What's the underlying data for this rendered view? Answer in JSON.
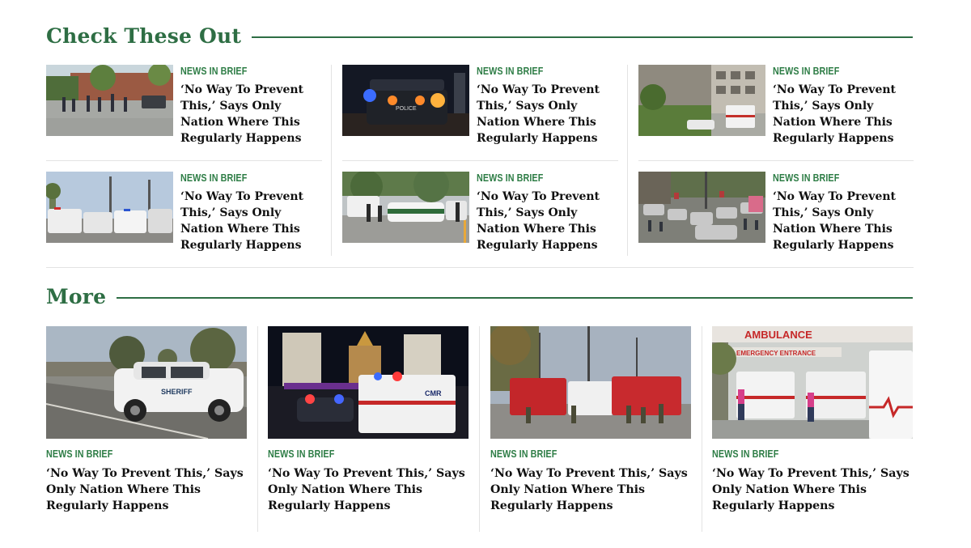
{
  "sections": {
    "check_these_out": "Check These Out",
    "more": "More"
  },
  "check_these_out": [
    {
      "kicker": "News in Brief",
      "headline": "‘No Way To Prevent This,’ Says Only Nation Where This Regularly Happens",
      "image": "school-evacuation-photo"
    },
    {
      "kicker": "News in Brief",
      "headline": "‘No Way To Prevent This,’ Says Only Nation Where This Regularly Happens",
      "image": "police-car-night-photo"
    },
    {
      "kicker": "News in Brief",
      "headline": "‘No Way To Prevent This,’ Says Only Nation Where This Regularly Happens",
      "image": "ambulance-building-photo"
    },
    {
      "kicker": "News in Brief",
      "headline": "‘No Way To Prevent This,’ Says Only Nation Where This Regularly Happens",
      "image": "emergency-vehicles-street-photo"
    },
    {
      "kicker": "News in Brief",
      "headline": "‘No Way To Prevent This,’ Says Only Nation Where This Regularly Happens",
      "image": "border-patrol-roadblock-photo"
    },
    {
      "kicker": "News in Brief",
      "headline": "‘No Way To Prevent This,’ Says Only Nation Where This Regularly Happens",
      "image": "crowded-parking-lot-photo"
    }
  ],
  "more": [
    {
      "kicker": "News in Brief",
      "headline": "‘No Way To Prevent This,’ Says Only Nation Where This Regularly Happens",
      "image": "sheriff-suv-photo",
      "vehicle_text": "SHERIFF"
    },
    {
      "kicker": "News in Brief",
      "headline": "‘No Way To Prevent This,’ Says Only Nation Where This Regularly Happens",
      "image": "las-vegas-night-ambulance-photo"
    },
    {
      "kicker": "News in Brief",
      "headline": "‘No Way To Prevent This,’ Says Only Nation Where This Regularly Happens",
      "image": "fire-trucks-street-photo"
    },
    {
      "kicker": "News in Brief",
      "headline": "‘No Way To Prevent This,’ Says Only Nation Where This Regularly Happens",
      "image": "hospital-ambulance-entrance-photo",
      "signage": [
        "AMBULANCE",
        "EMERGENCY ENTRANCE"
      ]
    }
  ],
  "colors": {
    "accent": "#2e6e44",
    "kicker": "#2e7d46",
    "divider": "#e3e3e3"
  }
}
